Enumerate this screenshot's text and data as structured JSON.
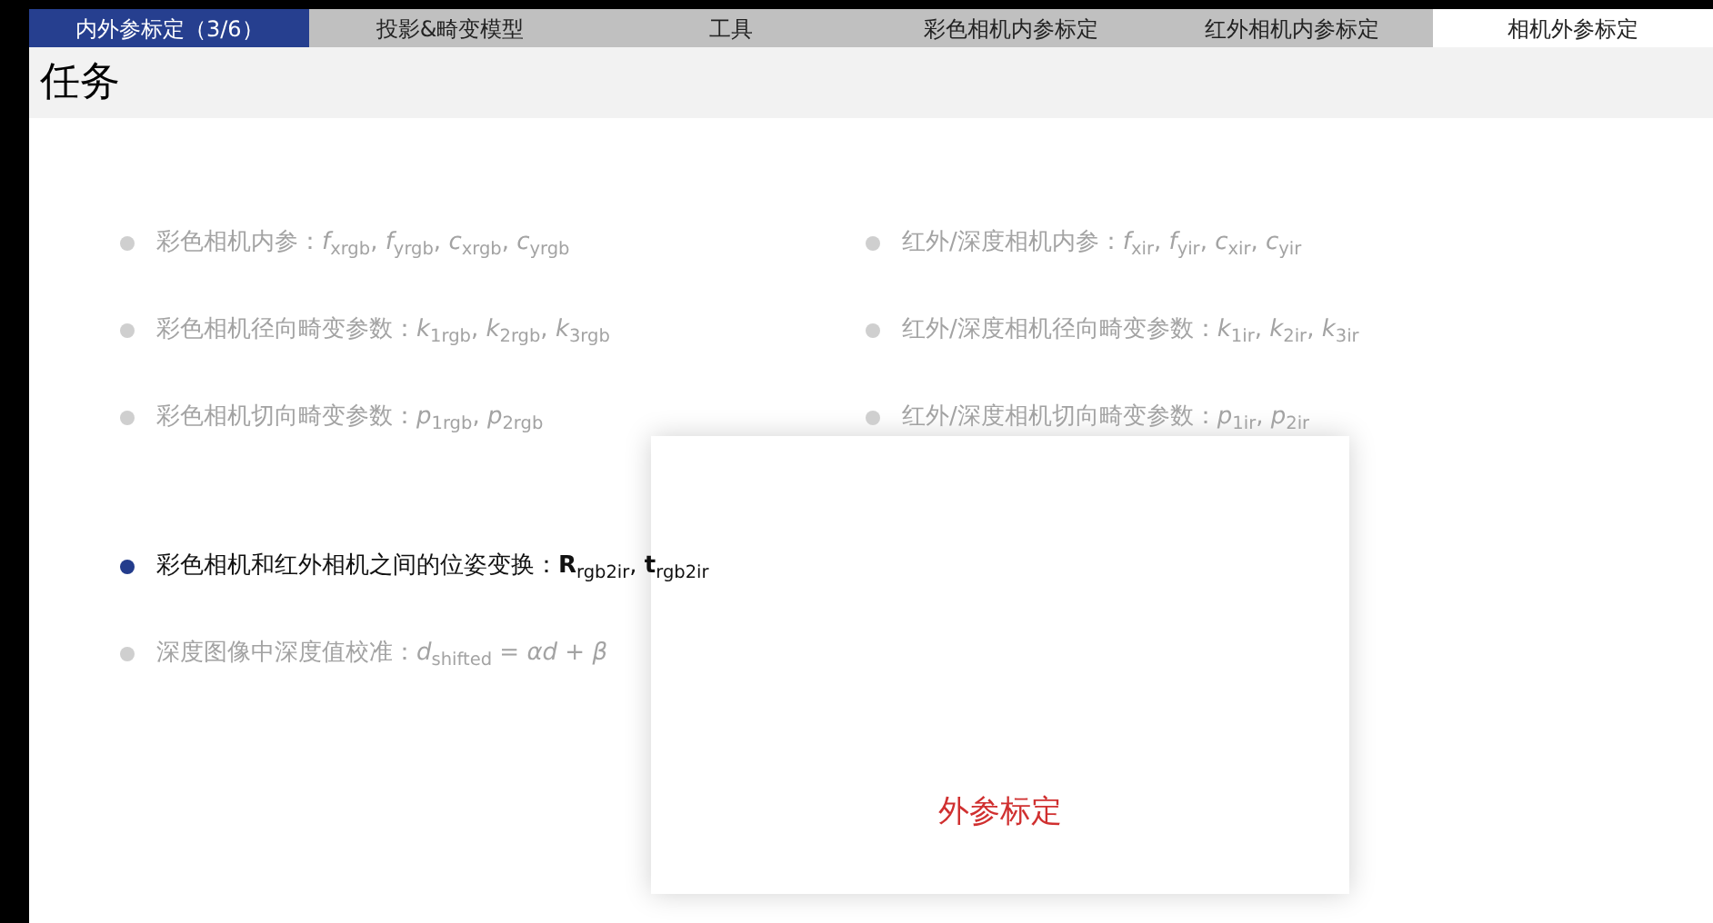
{
  "tabs": [
    {
      "label": "内外参标定（3/6）",
      "selected": true
    },
    {
      "label": "投影&畸变模型",
      "selected": false
    },
    {
      "label": "工具",
      "selected": false
    },
    {
      "label": "彩色相机内参标定",
      "selected": false
    },
    {
      "label": "红外相机内参标定",
      "selected": false
    },
    {
      "label": "相机外参标定",
      "selected": false
    }
  ],
  "title": "任务",
  "grid_items": [
    {
      "text": "彩色相机内参：*f*$_{xrgb}$, *f*$_{yrgb}$, *c*$_{xrgb}$, *c*$_{yrgb}$",
      "active": false
    },
    {
      "text": "红外/深度相机内参：*f*$_{xir}$, *f*$_{yir}$, *c*$_{xir}$, *c*$_{yir}$",
      "active": false
    },
    {
      "text": "彩色相机径向畸变参数：*k*$_{1rgb}$, *k*$_{2rgb}$, *k*$_{3rgb}$",
      "active": false
    },
    {
      "text": "红外/深度相机径向畸变参数：*k*$_{1ir}$, *k*$_{2ir}$, *k*$_{3ir}$",
      "active": false
    },
    {
      "text": "彩色相机切向畸变参数：*p*$_{1rgb}$, *p*$_{2rgb}$",
      "active": false
    },
    {
      "text": "红外/深度相机切向畸变参数：*p*$_{1ir}$, *p*$_{2ir}$",
      "active": false
    }
  ],
  "items": [
    {
      "text": "彩色相机和红外相机之间的位姿变换：**R**$_{rgb2ir}$, **t**$_{rgb2ir}$",
      "active": true
    },
    {
      "text": "深度图像中深度值校准：*d*$_{shifted}$ = *αd* + *β*",
      "active": false
    }
  ],
  "popup": {
    "label": "外参标定"
  }
}
